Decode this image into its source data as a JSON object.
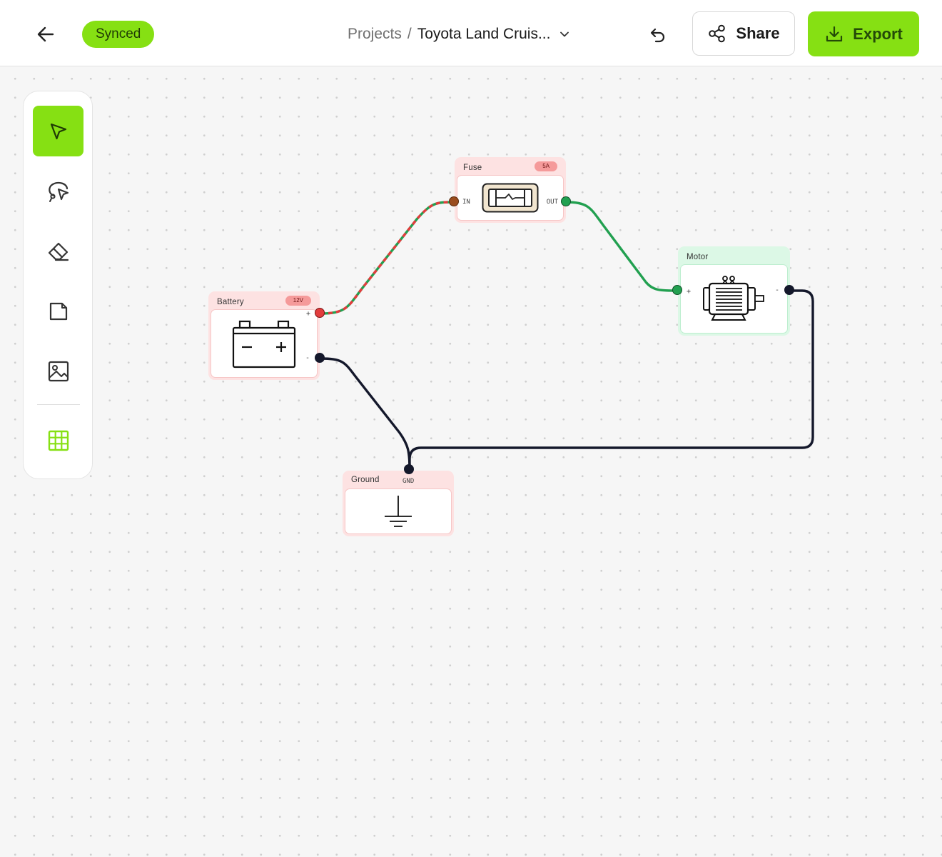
{
  "header": {
    "sync_status": "Synced",
    "breadcrumb_root": "Projects",
    "breadcrumb_separator": "/",
    "project_name": "Toyota Land Cruis...",
    "share_label": "Share",
    "export_label": "Export"
  },
  "toolbar": {
    "tools": [
      {
        "name": "select",
        "icon": "cursor-arrow-icon",
        "active": true
      },
      {
        "name": "lasso",
        "icon": "lasso-icon",
        "active": false
      },
      {
        "name": "eraser",
        "icon": "eraser-icon",
        "active": false
      },
      {
        "name": "note",
        "icon": "note-icon",
        "active": false
      },
      {
        "name": "image",
        "icon": "image-icon",
        "active": false
      },
      {
        "name": "grid",
        "icon": "grid-icon",
        "active": false
      }
    ]
  },
  "nodes": {
    "battery": {
      "title": "Battery",
      "badge": "12V",
      "port_pos": "+",
      "port_neg": "-"
    },
    "fuse": {
      "title": "Fuse",
      "badge": "5A",
      "port_in": "IN",
      "port_out": "OUT"
    },
    "motor": {
      "title": "Motor",
      "port_pos": "+",
      "port_neg": "-"
    },
    "ground": {
      "title": "Ground",
      "port_gnd": "GND"
    }
  },
  "colors": {
    "accent": "#86e013",
    "wire_positive": "#e23d3d",
    "wire_protected": "#22a050",
    "wire_ground": "#14182b",
    "node_red_bg": "#fde2e2",
    "node_green_bg": "#dcf8e6"
  }
}
